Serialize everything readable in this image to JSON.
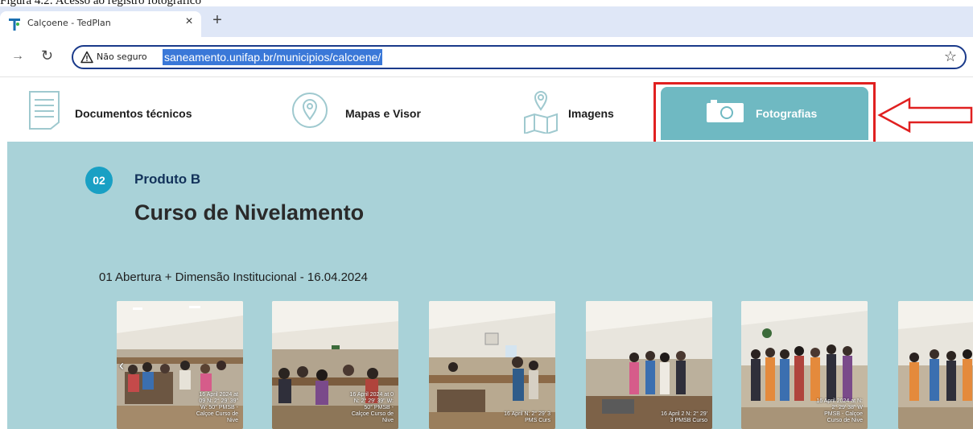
{
  "caption": "Figura 4.2: Acesso ao registro fotográfico",
  "browser": {
    "tab_title": "Calçoene - TedPlan",
    "tab_close": "×",
    "new_tab": "+",
    "security_label": "Não seguro",
    "url": "saneamento.unifap.br/municipios/calcoene/"
  },
  "nav": {
    "items": [
      {
        "label": "Documentos técnicos",
        "icon": "document-icon"
      },
      {
        "label": "Mapas e Visor",
        "icon": "map-pin-icon"
      },
      {
        "label": "Imagens",
        "icon": "folded-map-icon"
      },
      {
        "label": "Fotografias",
        "icon": "camera-icon",
        "active": true
      }
    ]
  },
  "content": {
    "badge": "02",
    "product": "Produto B",
    "course": "Curso de Nivelamento",
    "section": "01 Abertura + Dimensão Institucional - 16.04.2024",
    "photos": [
      {
        "stamp": "16 April 2024 at 09 N: 2° 29' 39\" W: 50° PMSB - Calçoe Curso de Nive"
      },
      {
        "stamp": "16 April 2024 at 0 N: 2° 29' 39\" W: 50° PMSB - Calçoe Curso de Nive"
      },
      {
        "stamp": "16 April N: 2° 29' 3 PMS Curs"
      },
      {
        "stamp": "16 April 2 N: 2° 29' 3 PMSB Curso"
      },
      {
        "stamp": "16 April 2024 at N: 2° 29' 38\" W PMSB - Calçoe Curso de Nive"
      },
      {
        "stamp": ""
      }
    ]
  },
  "colors": {
    "content_bg": "#a9d2d8",
    "active_tab": "#6fb9c2",
    "badge": "#19a0c4",
    "highlight": "#e02020",
    "url_highlight": "#3a78d8"
  }
}
